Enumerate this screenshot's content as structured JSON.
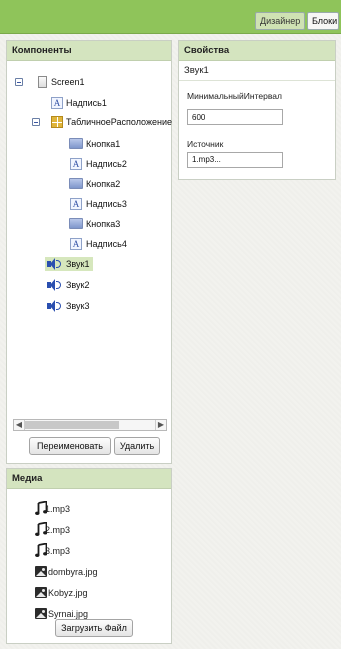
{
  "toolbar": {
    "designer_label": "Дизайнер",
    "blocks_label": "Блоки"
  },
  "components": {
    "title": "Компоненты",
    "tree": [
      {
        "label": "Screen1",
        "icon": "screen-icon"
      },
      {
        "label": "Надпись1",
        "icon": "label-icon"
      },
      {
        "label": "ТабличноеРасположение",
        "icon": "table-arrangement-icon"
      },
      {
        "label": "Кнопка1",
        "icon": "button-icon"
      },
      {
        "label": "Надпись2",
        "icon": "label-icon"
      },
      {
        "label": "Кнопка2",
        "icon": "button-icon"
      },
      {
        "label": "Надпись3",
        "icon": "label-icon"
      },
      {
        "label": "Кнопка3",
        "icon": "button-icon"
      },
      {
        "label": "Надпись4",
        "icon": "label-icon"
      },
      {
        "label": "Звук1",
        "icon": "sound-icon",
        "selected": true
      },
      {
        "label": "Звук2",
        "icon": "sound-icon"
      },
      {
        "label": "Звук3",
        "icon": "sound-icon"
      }
    ],
    "rename_label": "Переименовать",
    "delete_label": "Удалить"
  },
  "properties": {
    "title": "Свойства",
    "component": "Звук1",
    "min_interval_label": "МинимальныйИнтервал",
    "min_interval_value": "600",
    "source_label": "Источник",
    "source_value": "1.mp3..."
  },
  "media": {
    "title": "Медиа",
    "files": [
      {
        "name": "1.mp3",
        "icon": "music-note-icon"
      },
      {
        "name": "2.mp3",
        "icon": "music-note-icon"
      },
      {
        "name": "3.mp3",
        "icon": "music-note-icon"
      },
      {
        "name": "dombyra.jpg",
        "icon": "image-icon"
      },
      {
        "name": "Kobyz.jpg",
        "icon": "image-icon"
      },
      {
        "name": "Syrnai.jpg",
        "icon": "image-icon"
      }
    ],
    "upload_label": "Загрузить Файл"
  },
  "colors": {
    "toolbar_green": "#8fc45a",
    "panel_header": "#d4e4bf",
    "selection": "#d6e7bd",
    "icon_blue": "#2a4fb0"
  }
}
